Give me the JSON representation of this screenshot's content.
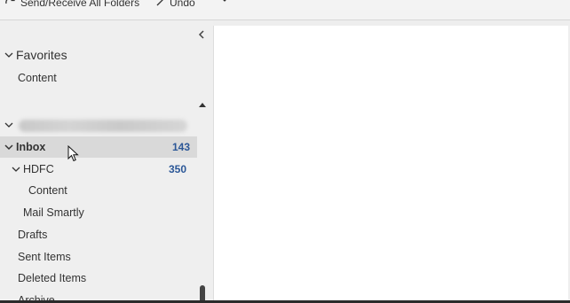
{
  "toolbar": {
    "send_receive_label": "Send/Receive All Folders",
    "undo_label": "Undo"
  },
  "sidebar": {
    "favorites": {
      "header": "Favorites",
      "items": [
        "Content"
      ]
    },
    "account": {
      "email": "amitbansalbyii@outlook.com",
      "folders": {
        "inbox": {
          "label": "Inbox",
          "count": "143"
        },
        "hdfc": {
          "label": "HDFC",
          "count": "350",
          "children": [
            "Content"
          ]
        },
        "mail_smartly": "Mail Smartly",
        "drafts": "Drafts",
        "sent_items": "Sent Items",
        "deleted_items": "Deleted Items",
        "archive": "Archive"
      }
    }
  }
}
